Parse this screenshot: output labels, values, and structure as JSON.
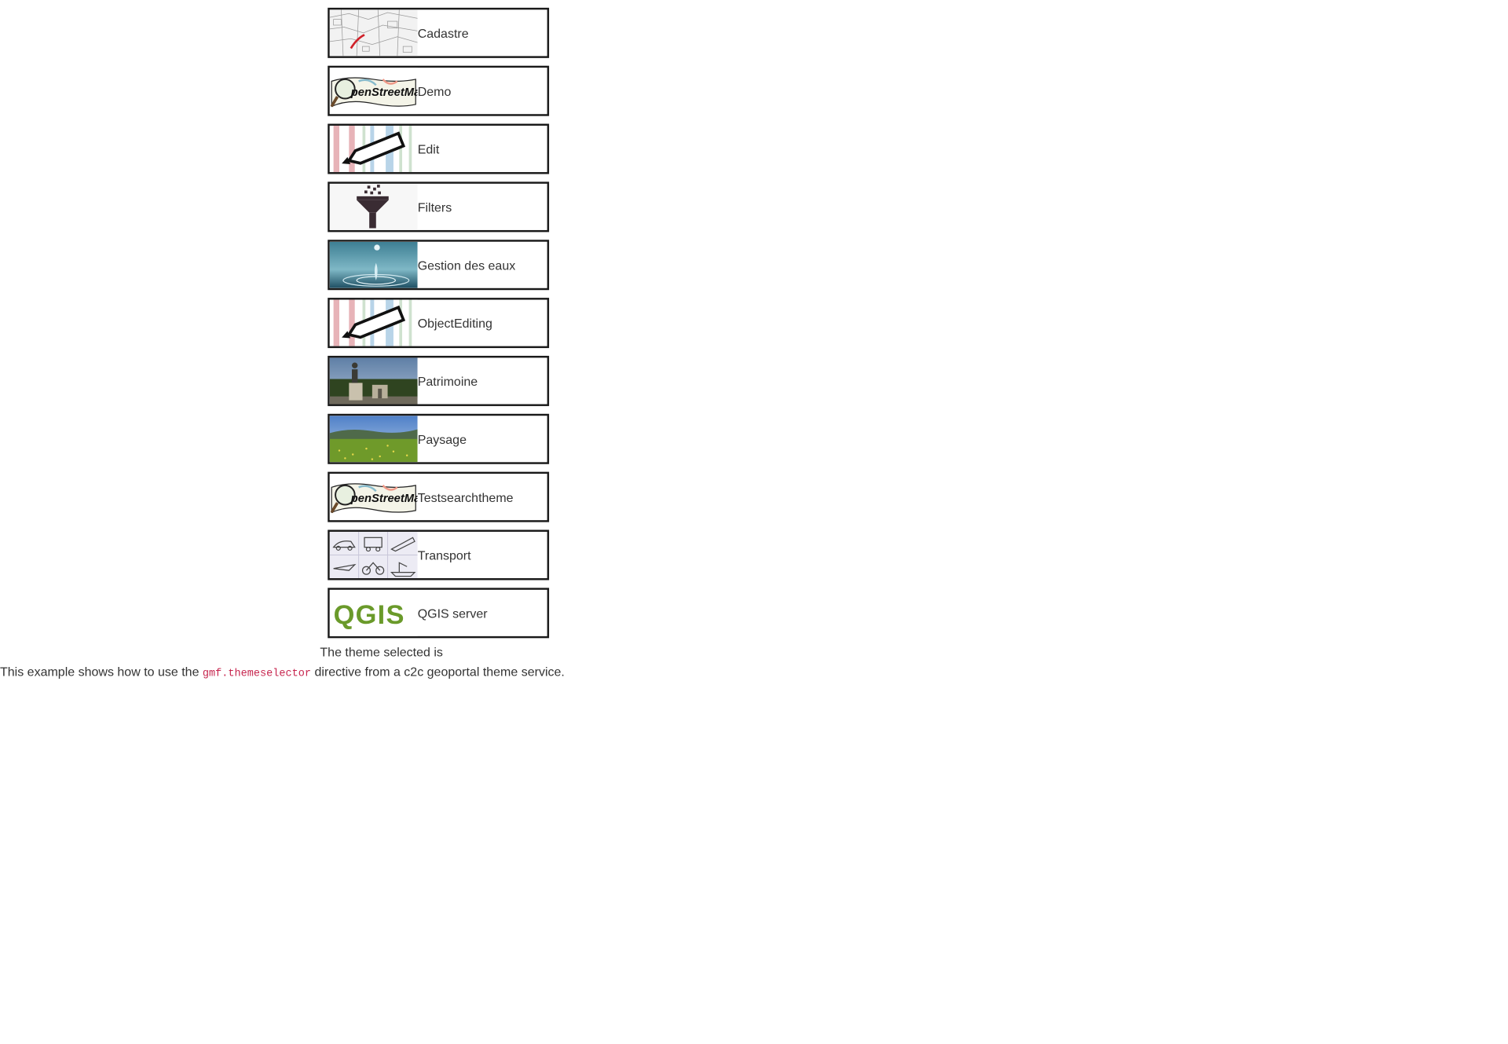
{
  "themes": [
    {
      "label": "Cadastre",
      "icon": "cadastre-map-thumbnail"
    },
    {
      "label": "Demo",
      "icon": "openstreetmap-logo-thumbnail"
    },
    {
      "label": "Edit",
      "icon": "pencil-stripes-thumbnail"
    },
    {
      "label": "Filters",
      "icon": "funnel-thumbnail"
    },
    {
      "label": "Gestion des eaux",
      "icon": "water-drop-thumbnail"
    },
    {
      "label": "ObjectEditing",
      "icon": "pencil-stripes-thumbnail"
    },
    {
      "label": "Patrimoine",
      "icon": "monument-photo-thumbnail"
    },
    {
      "label": "Paysage",
      "icon": "landscape-photo-thumbnail"
    },
    {
      "label": "Testsearchtheme",
      "icon": "openstreetmap-logo-thumbnail"
    },
    {
      "label": "Transport",
      "icon": "transport-vehicles-thumbnail"
    },
    {
      "label": "QGIS server",
      "icon": "qgis-logo-thumbnail"
    }
  ],
  "selected": {
    "label": "The theme selected is"
  },
  "description": {
    "prefix": "This example shows how to use the ",
    "code": "gmf.themeselector",
    "suffix": " directive from a c2c geoportal theme service."
  },
  "colors": {
    "border": "#1a1a1a",
    "text": "#333333",
    "code": "#c7254e",
    "qgis_green": "#6a9a2a"
  }
}
